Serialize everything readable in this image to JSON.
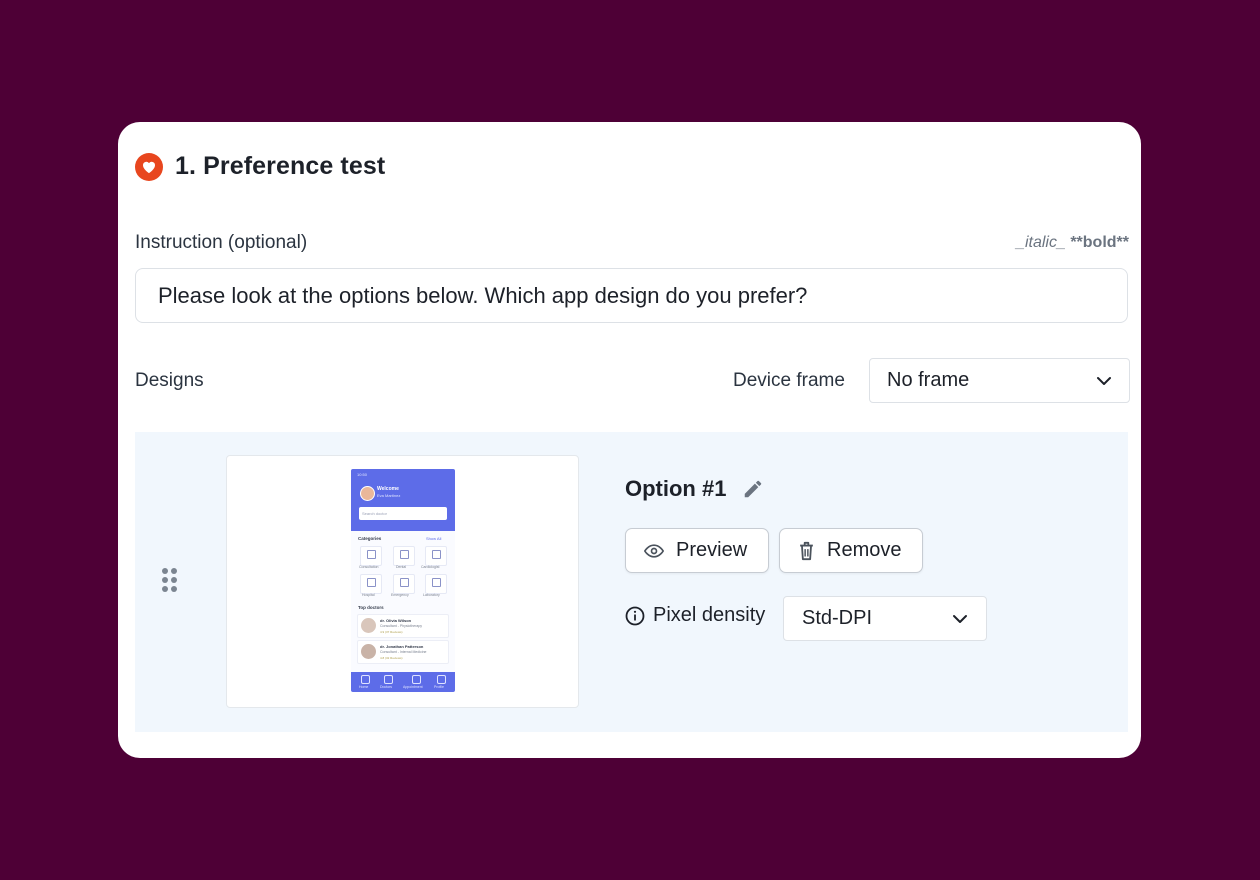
{
  "header": {
    "title": "1. Preference test",
    "icon": "heart-icon",
    "accent": "#e8461e"
  },
  "instruction": {
    "label": "Instruction (optional)",
    "format_hint_italic": "_italic_",
    "format_hint_bold": "**bold**",
    "value": "Please look at the options below. Which app design do you prefer?"
  },
  "designs": {
    "label": "Designs",
    "device_frame_label": "Device frame",
    "device_frame_value": "No frame"
  },
  "option": {
    "title": "Option #1",
    "preview_label": "Preview",
    "remove_label": "Remove",
    "density_label": "Pixel density",
    "density_value": "Std-DPI"
  },
  "thumbnail": {
    "status_time": "10:50",
    "welcome": "Welcome",
    "user_name": "Eva Martinez",
    "search_placeholder": "Search doctor",
    "categories_title": "Categories",
    "show_all": "Show All",
    "categories": [
      "Consultation",
      "Dental",
      "Cardiologist",
      "Hospital",
      "Emergency",
      "Laboratory"
    ],
    "top_doctors_title": "Top doctors",
    "doctors": [
      {
        "name": "dr. Olivia Wilson",
        "specialty": "Consultant - Physiotherapy",
        "rating": "4.9 (37 Reviews)"
      },
      {
        "name": "dr. Jonathan Patterson",
        "specialty": "Consultant - Internal Medicine",
        "rating": "4.8 (32 Reviews)"
      }
    ],
    "nav": [
      "Home",
      "Doctors",
      "Appointment",
      "Profile"
    ]
  },
  "colors": {
    "background": "#4e0036",
    "panel": "#f1f7fd",
    "phone_primary": "#5d6ce8"
  }
}
